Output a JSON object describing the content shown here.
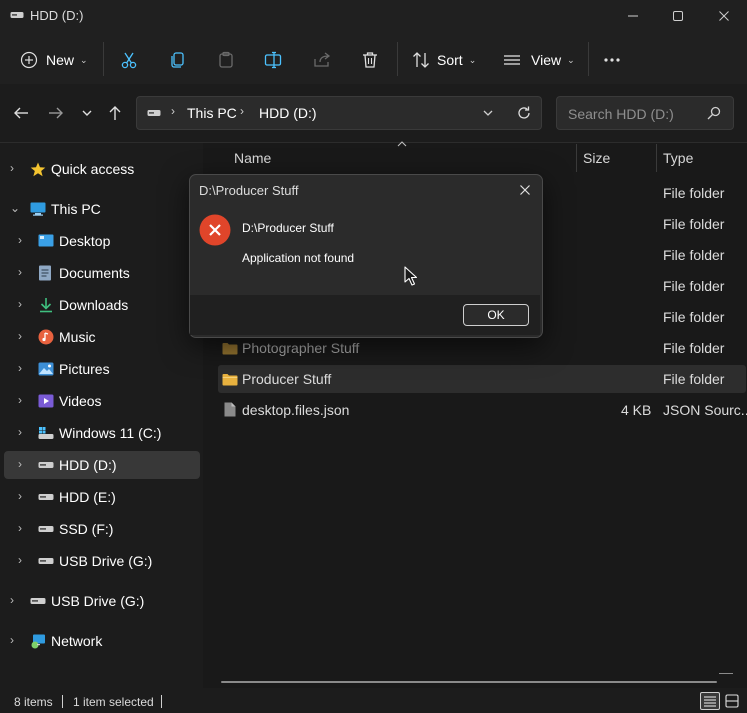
{
  "window": {
    "title": "HDD (D:)"
  },
  "toolbar": {
    "new_label": "New",
    "sort_label": "Sort",
    "view_label": "View"
  },
  "address": {
    "crumbs": [
      "This PC",
      "HDD (D:)"
    ]
  },
  "search": {
    "placeholder": "Search HDD (D:)"
  },
  "sidebar": {
    "items": [
      {
        "label": "Quick access",
        "icon": "star-icon"
      },
      {
        "label": "This PC",
        "icon": "pc-icon"
      },
      {
        "label": "Desktop",
        "icon": "desktop-icon"
      },
      {
        "label": "Documents",
        "icon": "documents-icon"
      },
      {
        "label": "Downloads",
        "icon": "download-icon"
      },
      {
        "label": "Music",
        "icon": "music-icon"
      },
      {
        "label": "Pictures",
        "icon": "pictures-icon"
      },
      {
        "label": "Videos",
        "icon": "videos-icon"
      },
      {
        "label": "Windows 11 (C:)",
        "icon": "system-drive-icon"
      },
      {
        "label": "HDD (D:)",
        "icon": "drive-icon"
      },
      {
        "label": "HDD (E:)",
        "icon": "drive-icon"
      },
      {
        "label": "SSD (F:)",
        "icon": "drive-icon"
      },
      {
        "label": "USB Drive (G:)",
        "icon": "drive-icon"
      },
      {
        "label": "USB Drive (G:)",
        "icon": "drive-icon"
      },
      {
        "label": "Network",
        "icon": "network-icon"
      }
    ]
  },
  "filelist": {
    "columns": {
      "name": "Name",
      "size": "Size",
      "type": "Type"
    },
    "rows": [
      {
        "name": "",
        "size": "",
        "type": "File folder"
      },
      {
        "name": "",
        "size": "",
        "type": "File folder"
      },
      {
        "name": "",
        "size": "",
        "type": "File folder"
      },
      {
        "name": "",
        "size": "",
        "type": "File folder"
      },
      {
        "name": "",
        "size": "",
        "type": "File folder"
      },
      {
        "name": "Photographer Stuff",
        "size": "",
        "type": "File folder"
      },
      {
        "name": "Producer Stuff",
        "size": "",
        "type": "File folder"
      },
      {
        "name": "desktop.files.json",
        "size": "4 KB",
        "type": "JSON Sourc..."
      }
    ]
  },
  "status": {
    "items_count": "8 items",
    "selected": "1 item selected"
  },
  "dialog": {
    "title": "D:\\Producer Stuff",
    "heading": "D:\\Producer Stuff",
    "message": "Application not found",
    "ok_label": "OK"
  },
  "colors": {
    "accent": "#4cc2ff",
    "folder": "#e8b23f",
    "error": "#e0452a",
    "background": "#191919"
  }
}
